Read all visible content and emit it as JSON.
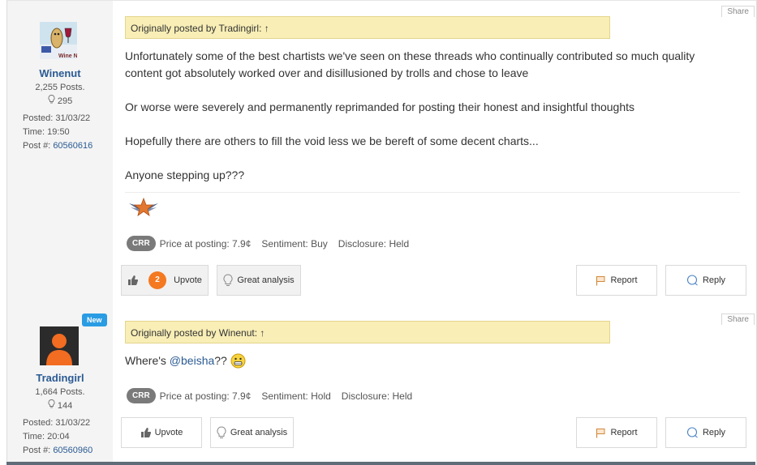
{
  "posts": [
    {
      "username": "Winenut",
      "posts_count": "2,255 Posts.",
      "likes": "295",
      "posted": "Posted: 31/03/22",
      "time": "Time: 19:50",
      "post_label": "Post #:",
      "post_number": "60560616",
      "share_label": "Share",
      "quote": "Originally posted by Tradingirl: ↑",
      "paragraphs": [
        "Unfortunately some of the best chartists we've seen on these threads who continually contributed so much quality content got absolutely worked over and disillusioned by trolls and chose to leave",
        "Or worse were severely and permanently reprimanded for posting their honest and insightful thoughts",
        "Hopefully there are others to fill the void less we be bereft of some decent charts...",
        "Anyone stepping up???"
      ],
      "stock_tag": "CRR",
      "price": "Price at posting: 7.9¢",
      "sentiment": "Sentiment: Buy",
      "disclosure": "Disclosure: Held",
      "upvote_count": "2",
      "upvote_label": "Upvote",
      "great_label": "Great analysis",
      "report_label": "Report",
      "reply_label": "Reply"
    },
    {
      "username": "Tradingirl",
      "new_badge": "New",
      "posts_count": "1,664 Posts.",
      "likes": "144",
      "posted": "Posted: 31/03/22",
      "time": "Time: 20:04",
      "post_label": "Post #:",
      "post_number": "60560960",
      "share_label": "Share",
      "quote": "Originally posted by Winenut: ↑",
      "text_prefix": "Where's ",
      "mention": "@beisha",
      "text_suffix": "??",
      "stock_tag": "CRR",
      "price": "Price at posting: 7.9¢",
      "sentiment": "Sentiment: Hold",
      "disclosure": "Disclosure: Held",
      "upvote_label": "Upvote",
      "great_label": "Great analysis",
      "report_label": "Report",
      "reply_label": "Reply"
    }
  ],
  "colors": {
    "accent_link": "#2a5a93",
    "quote_bg": "#f8eeb6",
    "upvote_count_bg": "#f47920",
    "new_badge_bg": "#2a9ce3"
  }
}
